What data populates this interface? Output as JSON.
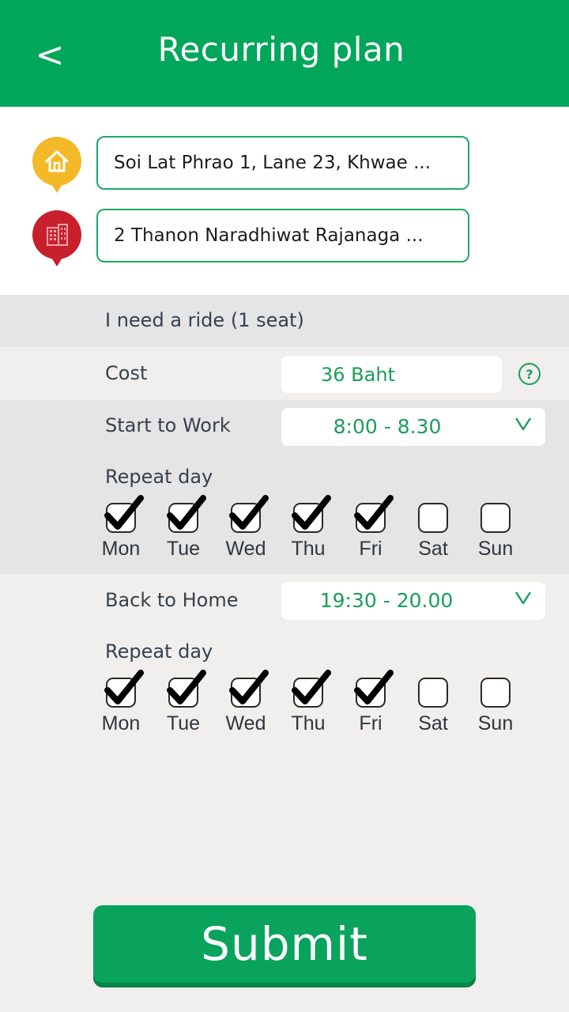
{
  "header": {
    "back_label": "<",
    "title": "Recurring plan"
  },
  "locations": {
    "origin": {
      "icon": "home-pin-icon",
      "value": "Soi Lat Phrao 1, Lane 23, Khwae ..."
    },
    "destination": {
      "icon": "building-pin-icon",
      "value": "2 Thanon Naradhiwat Rajanaga ..."
    }
  },
  "ride": {
    "label": "I need a ride (1 seat)"
  },
  "cost": {
    "label": "Cost",
    "value": "36 Baht",
    "help_icon": "question-circle-icon"
  },
  "start_to_work": {
    "label": "Start to Work",
    "time": "8:00 - 8.30",
    "chevron": "V",
    "repeat_label": "Repeat day",
    "days": [
      {
        "label": "Mon",
        "checked": true
      },
      {
        "label": "Tue",
        "checked": true
      },
      {
        "label": "Wed",
        "checked": true
      },
      {
        "label": "Thu",
        "checked": true
      },
      {
        "label": "Fri",
        "checked": true
      },
      {
        "label": "Sat",
        "checked": false
      },
      {
        "label": "Sun",
        "checked": false
      }
    ]
  },
  "back_to_home": {
    "label": "Back to Home",
    "time": "19:30 - 20.00",
    "chevron": "V",
    "repeat_label": "Repeat day",
    "days": [
      {
        "label": "Mon",
        "checked": true
      },
      {
        "label": "Tue",
        "checked": true
      },
      {
        "label": "Wed",
        "checked": true
      },
      {
        "label": "Thu",
        "checked": true
      },
      {
        "label": "Fri",
        "checked": true
      },
      {
        "label": "Sat",
        "checked": false
      },
      {
        "label": "Sun",
        "checked": false
      }
    ]
  },
  "submit": {
    "label": "Submit"
  },
  "colors": {
    "brand_green": "#00a65a",
    "accent_text_green": "#1a9e57",
    "home_pin": "#f3b928",
    "work_pin": "#c81f2c"
  }
}
